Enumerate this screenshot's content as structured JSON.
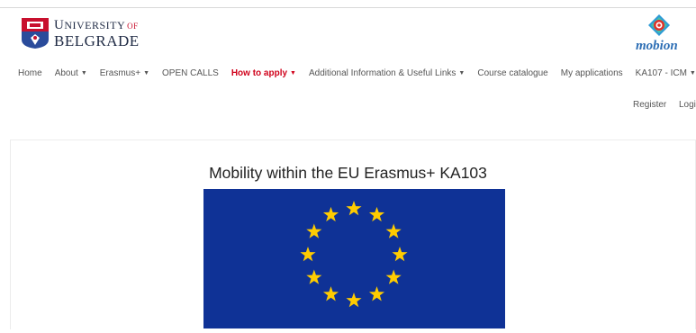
{
  "header": {
    "university": {
      "line1_initial": "U",
      "line1_rest": "NIVERSITY",
      "line1_suffix": "OF",
      "line2": "BELGRADE"
    },
    "partner_logo_text": "mobion"
  },
  "nav": {
    "items": [
      {
        "label": "Home",
        "dropdown": false,
        "highlighted": false
      },
      {
        "label": "About",
        "dropdown": true,
        "highlighted": false
      },
      {
        "label": "Erasmus+",
        "dropdown": true,
        "highlighted": false
      },
      {
        "label": "OPEN CALLS",
        "dropdown": false,
        "highlighted": false
      },
      {
        "label": "How to apply",
        "dropdown": true,
        "highlighted": true
      },
      {
        "label": "Additional Information & Useful Links",
        "dropdown": true,
        "highlighted": false
      },
      {
        "label": "Course catalogue",
        "dropdown": false,
        "highlighted": false
      },
      {
        "label": "My applications",
        "dropdown": false,
        "highlighted": false
      },
      {
        "label": "KA107 - ICM",
        "dropdown": true,
        "highlighted": false
      }
    ],
    "register_label": "Register",
    "login_label": "Logi"
  },
  "main": {
    "title": "Mobility within the EU Erasmus+ KA103",
    "flag_colors": {
      "background": "#0f3296",
      "stars": "#ffcc00"
    }
  },
  "colors": {
    "highlight": "#d0021b",
    "nav_text": "#555555",
    "crest_red": "#c8102e",
    "mobion_blue": "#2e6fb5"
  }
}
